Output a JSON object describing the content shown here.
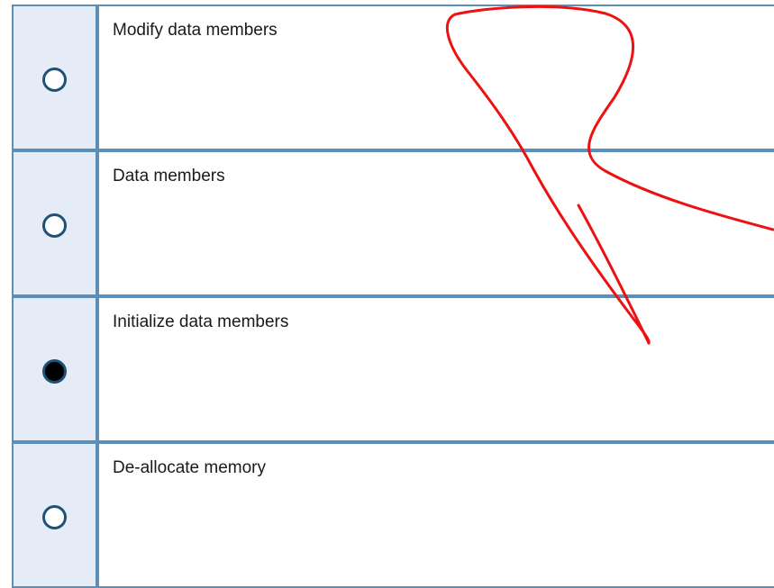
{
  "question": {
    "options": [
      {
        "label": "Modify data members",
        "selected": false
      },
      {
        "label": "Data members",
        "selected": false
      },
      {
        "label": "Initialize data members",
        "selected": true
      },
      {
        "label": "De-allocate memory",
        "selected": false
      }
    ]
  },
  "colors": {
    "row_border": "#5c8fb8",
    "radio_cell_bg": "#e6ecf7",
    "radio_ring": "#1d5278",
    "annotation_stroke": "#ee1111"
  }
}
